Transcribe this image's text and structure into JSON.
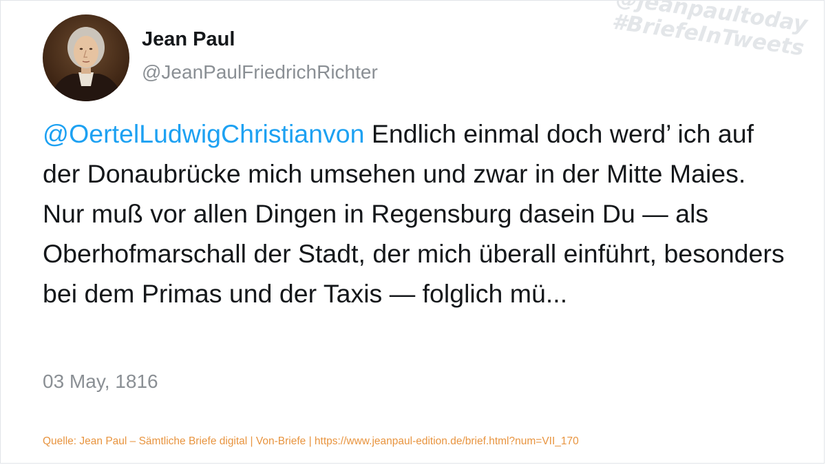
{
  "author": {
    "name": "Jean Paul",
    "handle": "@JeanPaulFriedrichRichter",
    "avatar_icon": "portrait-avatar"
  },
  "watermark": {
    "line1": "@jeanpaultoday",
    "line2": "#BriefeInTweets"
  },
  "tweet": {
    "mention": "@OertelLudwigChristianvon",
    "text": " Endlich einmal doch werd’ ich auf der Donaubrücke mich umsehen und zwar in der Mitte Maies. Nur muß vor allen Dingen in Regensburg dasein Du — als Oberhofmarschall der Stadt, der mich überall einführt, besonders bei dem Primas und der Taxis — folglich mü...",
    "date": "03 May, 1816"
  },
  "source": "Quelle: Jean Paul – Sämtliche Briefe digital | Von-Briefe | https://www.jeanpaul-edition.de/brief.html?num=VII_170",
  "colors": {
    "mention": "#1da1f2",
    "text": "#14171a",
    "muted": "#8a8f94",
    "source": "#e8943f",
    "watermark": "#e3e6e9"
  }
}
